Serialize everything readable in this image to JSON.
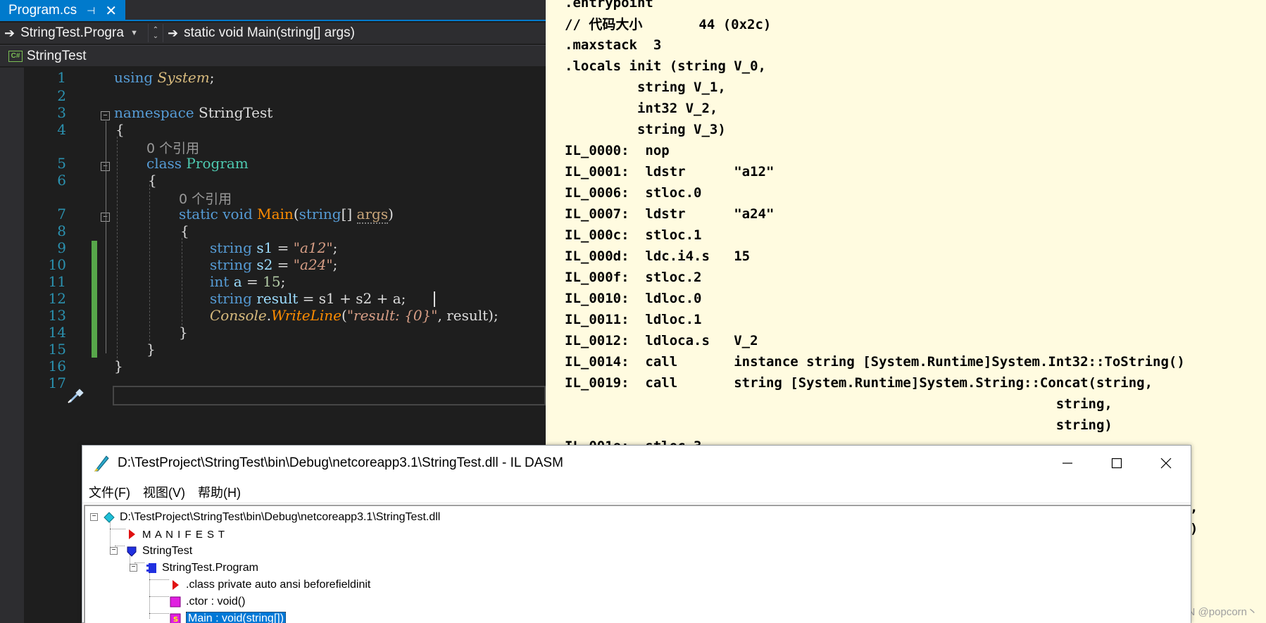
{
  "editor": {
    "tab": {
      "title": "Program.cs",
      "pin_icon": "pin-icon",
      "close_icon": "close-icon"
    },
    "nav": {
      "left_dropdown": "StringTest.Progra",
      "right_dropdown": "static void Main(string[] args)"
    },
    "project": "StringTest",
    "line_numbers": [
      "1",
      "2",
      "3",
      "4",
      "5",
      "6",
      "7",
      "8",
      "9",
      "10",
      "11",
      "12",
      "13",
      "14",
      "15",
      "16",
      "17"
    ],
    "refs_hint": "0 个引用",
    "code": {
      "using": "using",
      "system": "System",
      "semicolon": ";",
      "namespace_kw": "namespace",
      "namespace_name": "StringTest",
      "class_kw": "class",
      "class_name": "Program",
      "static_void": "static void",
      "main": "Main",
      "string_kw": "string",
      "args": "args",
      "s1_decl": "s1",
      "s1_val": "\"a12\"",
      "s2_decl": "s2",
      "s2_val": "\"a24\"",
      "int_kw": "int",
      "a_var": "a",
      "a_val": "15",
      "result_var": "result",
      "result_expr": " = s1 + s2 + a;",
      "console": "Console",
      "writeline": "WriteLine",
      "format_str": "\"result: {0}\"",
      "writeline_tail": ", result);",
      "open_brace": "{",
      "close_brace": "}"
    }
  },
  "il": {
    "lines": [
      ".entrypoint",
      "// 代码大小       44 (0x2c)",
      ".maxstack  3",
      ".locals init (string V_0,",
      "         string V_1,",
      "         int32 V_2,",
      "         string V_3)",
      "IL_0000:  nop",
      "IL_0001:  ldstr      \"a12\"",
      "IL_0006:  stloc.0",
      "IL_0007:  ldstr      \"a24\"",
      "IL_000c:  stloc.1",
      "IL_000d:  ldc.i4.s   15",
      "IL_000f:  stloc.2",
      "IL_0010:  ldloc.0",
      "IL_0011:  ldloc.1",
      "IL_0012:  ldloca.s   V_2",
      "IL_0014:  call       instance string [System.Runtime]System.Int32::ToString()",
      "IL_0019:  call       string [System.Runtime]System.String::Concat(string,",
      "                                                             string,",
      "                                                             string)",
      "IL_001e:  stloc.3"
    ],
    "tail_marks": [
      ",",
      ")"
    ],
    "watermark": "CSDN @popcorn丶"
  },
  "ildasm": {
    "title": "D:\\TestProject\\StringTest\\bin\\Debug\\netcoreapp3.1\\StringTest.dll - IL DASM",
    "menu": [
      "文件(F)",
      "视图(V)",
      "帮助(H)"
    ],
    "tree": {
      "root": "D:\\TestProject\\StringTest\\bin\\Debug\\netcoreapp3.1\\StringTest.dll",
      "manifest": "M A N I F E S T",
      "namespace": "StringTest",
      "class": "StringTest.Program",
      "class_decl": ".class private auto ansi beforefieldinit",
      "ctor": ".ctor : void()",
      "main": "Main : void(string[])"
    },
    "colors": {
      "selection": "#0078d7"
    }
  },
  "colors": {
    "accent": "#007acc",
    "keyword": "#569cd6",
    "type": "#4ec9b0",
    "string": "#d69d85",
    "method": "#ff8c00",
    "il_background": "#fffbe0"
  }
}
